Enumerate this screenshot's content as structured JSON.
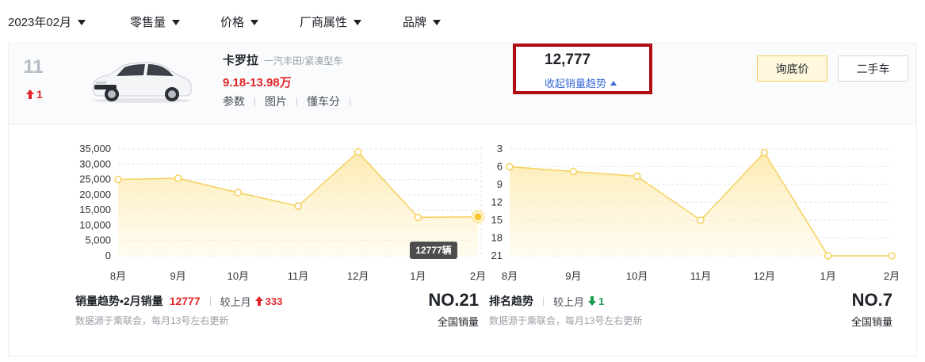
{
  "filters": [
    {
      "label": "2023年02月"
    },
    {
      "label": "零售量"
    },
    {
      "label": "价格"
    },
    {
      "label": "厂商属性"
    },
    {
      "label": "品牌"
    }
  ],
  "car": {
    "rank": "11",
    "rank_change": "1",
    "name": "卡罗拉",
    "maker": "一汽丰田/紧凑型车",
    "price": "9.18-13.98万",
    "links": [
      "参数",
      "图片",
      "懂车分"
    ],
    "sales": "12,777",
    "toggle_label": "收起销量趋势"
  },
  "buttons": {
    "ask_price": "询底价",
    "used_car": "二手车"
  },
  "colors": {
    "accent_red": "#e0262a",
    "line": "#f5d15c",
    "highlight_border": "#b00d12",
    "link_blue": "#3a6bd6",
    "down_green": "#1a9c4a"
  },
  "chart_data": [
    {
      "type": "area",
      "categories": [
        "8月",
        "9月",
        "10月",
        "11月",
        "12月",
        "1月",
        "2月"
      ],
      "values": [
        25000,
        25400,
        20700,
        16300,
        34000,
        12600,
        12777
      ],
      "ylim": [
        0,
        35000
      ],
      "yticks": [
        "0",
        "5,000",
        "10,000",
        "15,000",
        "20,000",
        "25,000",
        "30,000",
        "35,000"
      ],
      "tooltip": "12777辆",
      "grid": true
    },
    {
      "type": "area",
      "categories": [
        "8月",
        "9月",
        "10月",
        "11月",
        "12月",
        "1月",
        "2月"
      ],
      "values": [
        6,
        6.8,
        7.6,
        15,
        3.6,
        21,
        21
      ],
      "ylim": [
        3,
        21
      ],
      "inverted": true,
      "yticks": [
        "3",
        "6",
        "9",
        "12",
        "15",
        "18",
        "21"
      ],
      "grid": true
    }
  ],
  "sales_panel": {
    "title": "销量趋势•2月销量",
    "value": "12777",
    "compare_label": "较上月",
    "delta": "333",
    "source": "数据源于乘联会，每月13号左右更新",
    "nat_rank": "NO.21",
    "nat_label": "全国销量"
  },
  "rank_panel": {
    "title": "排名趋势",
    "compare_label": "较上月",
    "delta": "1",
    "source": "数据源于乘联会，每月13号左右更新",
    "nat_rank": "NO.7",
    "nat_label": "全国销量"
  }
}
